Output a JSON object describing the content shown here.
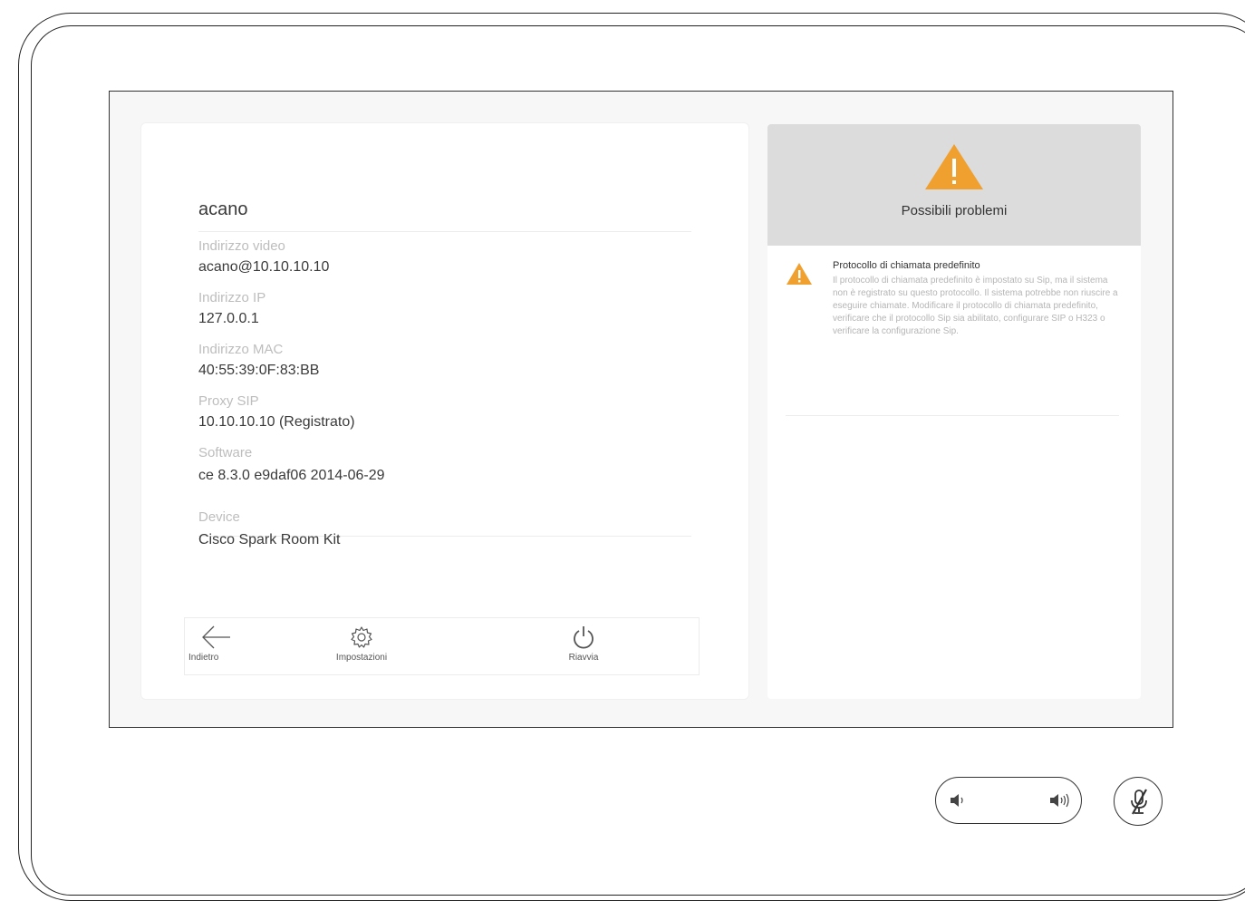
{
  "device": {
    "title": "acano",
    "fields": [
      {
        "label": "Indirizzo video",
        "value": "acano@10.10.10.10"
      },
      {
        "label": "Indirizzo IP",
        "value": "127.0.0.1"
      },
      {
        "label": "Indirizzo MAC",
        "value": "40:55:39:0F:83:BB"
      },
      {
        "label": "Proxy SIP",
        "value": "10.10.10.10 (Registrato)"
      },
      {
        "label": "Software",
        "value": "ce 8.3.0 e9daf06 2014-06-29"
      },
      {
        "label": "Device",
        "value": "Cisco Spark Room Kit"
      }
    ]
  },
  "bottom_bar": {
    "back_label": "Indietro",
    "settings_label": "Impostazioni",
    "restart_label": "Riavvia"
  },
  "issues": {
    "header_title": "Possibili problemi",
    "items": [
      {
        "title": "Protocollo di chiamata predefinito",
        "description": "Il protocollo di chiamata predefinito è impostato su Sip, ma il sistema non è registrato su questo protocollo. Il sistema potrebbe non riuscire a eseguire chiamate. Modificare il protocollo di chiamata predefinito, verificare che il protocollo Sip sia abilitato, configurare SIP o H323 o verificare la configurazione Sip."
      }
    ]
  },
  "colors": {
    "warning": "#f0a02e",
    "header_bg": "#dcdcdc"
  },
  "icons": {
    "back": "arrow-left-icon",
    "settings": "gear-icon",
    "restart": "power-icon",
    "volume_down": "volume-down-icon",
    "volume_up": "volume-up-icon",
    "mute": "microphone-muted-icon",
    "warning": "warning-triangle-icon"
  }
}
